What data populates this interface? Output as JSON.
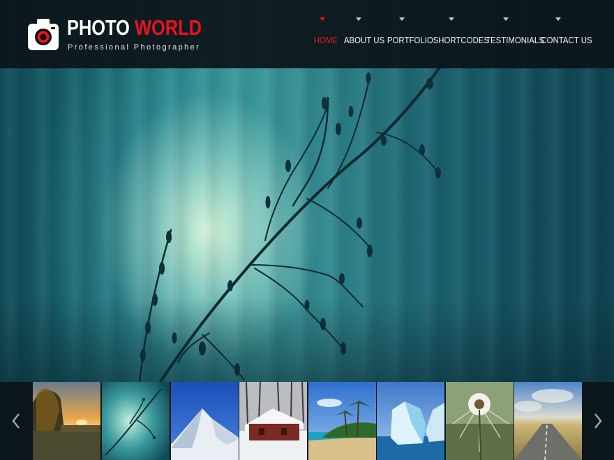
{
  "brand": {
    "name_part1": "PHOTO",
    "name_part2": "WORLD",
    "tagline": "Professional Photographer"
  },
  "nav": {
    "items": [
      {
        "label": "HOME",
        "active": true
      },
      {
        "label": "ABOUT US",
        "active": false
      },
      {
        "label": "PORTFOLIO",
        "active": false
      },
      {
        "label": "SHORTCODES",
        "active": false
      },
      {
        "label": "TESTIMONIALS",
        "active": false
      },
      {
        "label": "CONTACT US",
        "active": false
      }
    ]
  },
  "slider": {
    "prev_icon": "chevron-left-icon",
    "next_icon": "chevron-right-icon",
    "thumbnails": [
      "sunset-lake",
      "plant-teal",
      "snow-mountain",
      "snow-cabin",
      "beach-palms",
      "iceberg",
      "dandelion",
      "country-road"
    ]
  },
  "colors": {
    "accent": "#e8131c",
    "header_bg": "#0c1418",
    "nav_text": "#f2f2f2"
  }
}
